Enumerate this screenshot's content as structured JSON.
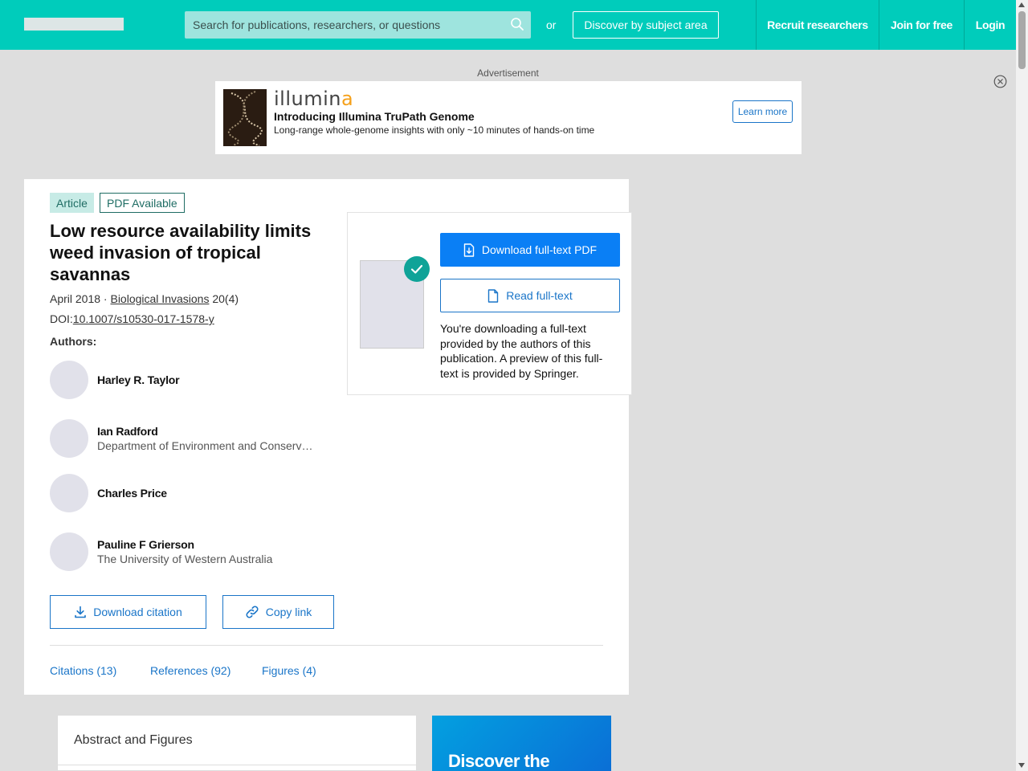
{
  "header": {
    "search_placeholder": "Search for publications, researchers, or questions",
    "or_text": "or",
    "discover_label": "Discover by subject area",
    "nav": [
      "Recruit researchers",
      "Join for free",
      "Login"
    ]
  },
  "ad": {
    "label": "Advertisement",
    "brand_part1": "illumin",
    "brand_part2": "a",
    "title": "Introducing Illumina TruPath Genome",
    "subtitle": "Long-range whole-genome insights with only ~10 minutes of hands-on time",
    "cta": "Learn more"
  },
  "article": {
    "tag_type": "Article",
    "tag_pdf": "PDF Available",
    "title": "Low resource availability limits weed invasion of tropical savannas",
    "date_prefix": "April 2018 · ",
    "journal": "Biological Invasions",
    "issue": " 20(4)",
    "doi_prefix": "DOI:",
    "doi": "10.1007/s10530-017-1578-y",
    "authors_label": "Authors:",
    "authors": [
      {
        "name": "Harley R. Taylor",
        "affiliation": ""
      },
      {
        "name": "Ian Radford",
        "affiliation": "Department of Environment and Conservation"
      },
      {
        "name": "Charles Price",
        "affiliation": ""
      },
      {
        "name": "Pauline F Grierson",
        "affiliation": "The University of Western Australia"
      }
    ],
    "download_citation": "Download citation",
    "copy_link": "Copy link",
    "tabs": [
      "Citations (13)",
      "References (92)",
      "Figures (4)"
    ]
  },
  "download_panel": {
    "pdf_button": "Download full-text PDF",
    "read_button": "Read full-text",
    "note": "You're downloading a full-text provided by the authors of this publication. A preview of this full-text is provided by Springer."
  },
  "lower": {
    "abstract_title": "Abstract and Figures",
    "promo_text": "Discover the"
  },
  "colors": {
    "brand_teal": "#00ccbb",
    "link_blue": "#1a75c8",
    "primary_blue": "#0a7ff5",
    "check_green": "#0fa398"
  }
}
